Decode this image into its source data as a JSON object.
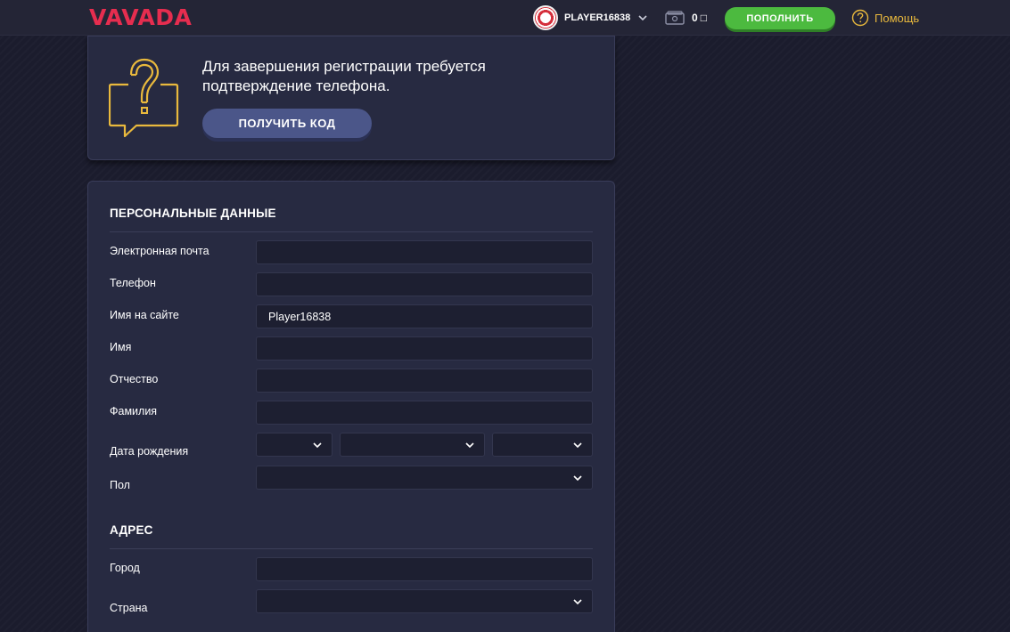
{
  "header": {
    "logo": "VAVADA",
    "username": "PLAYER16838",
    "balance": "0",
    "currency": "□",
    "deposit_label": "ПОПОЛНИТЬ",
    "help_label": "Помощь",
    "colors": {
      "logo": "#e62d4f",
      "deposit": "#4cba3f",
      "help": "#e9b93d"
    }
  },
  "verify": {
    "message": "Для завершения регистрации требуется подтверждение телефона.",
    "button_label": "ПОЛУЧИТЬ КОД",
    "icon": "question-bubble-icon"
  },
  "personal": {
    "title": "ПЕРСОНАЛЬНЫЕ ДАННЫЕ",
    "email_label": "Электронная почта",
    "email_value": "",
    "phone_label": "Телефон",
    "phone_value": "",
    "nickname_label": "Имя на сайте",
    "nickname_value": "Player16838",
    "first_name_label": "Имя",
    "first_name_value": "",
    "patronymic_label": "Отчество",
    "patronymic_value": "",
    "last_name_label": "Фамилия",
    "last_name_value": "",
    "birth_label": "Дата рождения",
    "gender_label": "Пол"
  },
  "address": {
    "title": "АДРЕС",
    "city_label": "Город",
    "city_value": "",
    "country_label": "Страна"
  }
}
